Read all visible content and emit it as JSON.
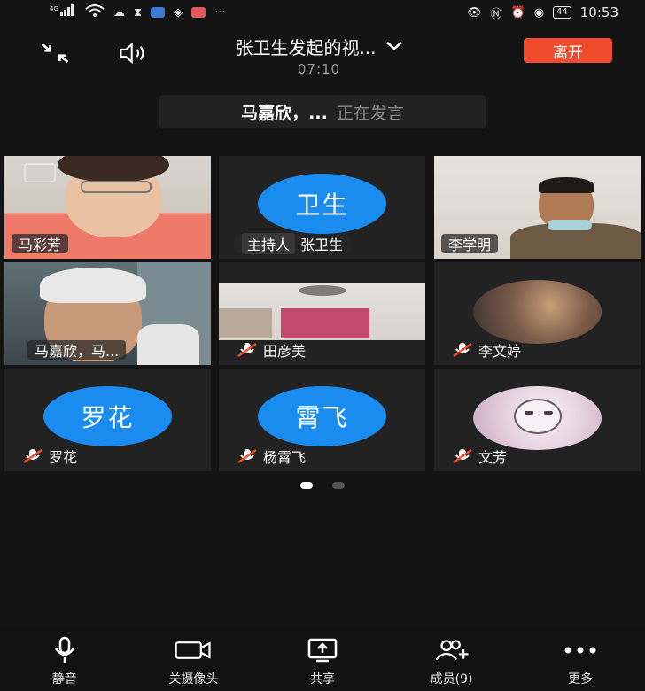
{
  "status_bar": {
    "signal": "4G",
    "battery": "44",
    "time": "10:53"
  },
  "header": {
    "title": "张卫生发起的视...",
    "timer": "07:10",
    "leave_label": "离开"
  },
  "speaking": {
    "name": "马嘉欣，...",
    "text": "正在发言"
  },
  "participants": [
    {
      "name": "马彩芳",
      "avatar": "",
      "muted": false
    },
    {
      "name": "张卫生",
      "role": "主持人",
      "avatar": "卫生",
      "muted": false
    },
    {
      "name": "李学明",
      "avatar": "",
      "muted": false
    },
    {
      "name": "马嘉欣，马...",
      "avatar": "",
      "muted": false,
      "active": true
    },
    {
      "name": "田彦美",
      "avatar": "",
      "muted": true
    },
    {
      "name": "李文婷",
      "avatar": "",
      "muted": true
    },
    {
      "name": "罗花",
      "avatar": "罗花",
      "muted": true
    },
    {
      "name": "杨霄飞",
      "avatar": "霄飞",
      "muted": true
    },
    {
      "name": "文芳",
      "avatar": "",
      "muted": true
    }
  ],
  "toolbar": {
    "mute_label": "静音",
    "camera_label": "关摄像头",
    "share_label": "共享",
    "members_label": "成员(9)",
    "more_label": "更多"
  },
  "colors": {
    "accent_leave": "#f04b2d",
    "avatar_blue": "#1a8cf0",
    "active_border": "#2fb24a"
  }
}
